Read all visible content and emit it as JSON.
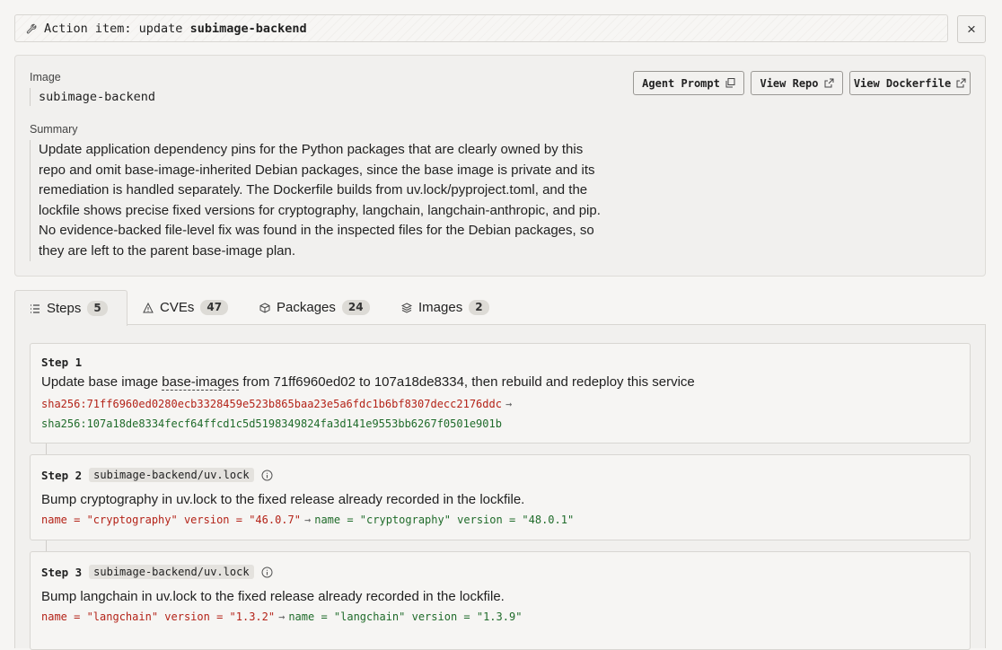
{
  "header": {
    "prefix": "Action item: update ",
    "name": "subimage-backend",
    "close": "×"
  },
  "info": {
    "image_label": "Image",
    "image_name": "subimage-backend",
    "summary_label": "Summary",
    "summary": "Update application dependency pins for the Python packages that are clearly owned by this repo and omit base-image-inherited Debian packages, since the base image is private and its remediation is handled separately. The Dockerfile builds from uv.lock/pyproject.toml, and the lockfile shows precise fixed versions for cryptography, langchain, langchain-anthropic, and pip. No evidence-backed file-level fix was found in the inspected files for the Debian packages, so they are left to the parent base-image plan.",
    "buttons": {
      "agent_prompt": "Agent Prompt",
      "view_repo": "View Repo",
      "view_dockerfile": "View Dockerfile"
    }
  },
  "tabs": [
    {
      "label": "Steps",
      "count": "5",
      "icon": "list-icon"
    },
    {
      "label": "CVEs",
      "count": "47",
      "icon": "warning-icon"
    },
    {
      "label": "Packages",
      "count": "24",
      "icon": "package-icon"
    },
    {
      "label": "Images",
      "count": "2",
      "icon": "layers-icon"
    }
  ],
  "steps": [
    {
      "label": "Step 1",
      "desc_pre": "Update base image ",
      "desc_link": "base-images",
      "desc_post": " from 71ff6960ed02 to 107a18de8334, then rebuild and redeploy this service",
      "old": "sha256:71ff6960ed0280ecb3328459e523b865baa23e5a6fdc1b6bf8307decc2176ddc",
      "arrow": "→",
      "new": "sha256:107a18de8334fecf64ffcd1c5d5198349824fa3d141e9553bb6267f0501e901b"
    },
    {
      "label": "Step 2",
      "file": "subimage-backend/uv.lock",
      "desc": "Bump cryptography in uv.lock to the fixed release already recorded in the lockfile.",
      "old": "name = \"cryptography\" version = \"46.0.7\"",
      "arrow": "→",
      "new": "name = \"cryptography\" version = \"48.0.1\""
    },
    {
      "label": "Step 3",
      "file": "subimage-backend/uv.lock",
      "desc": "Bump langchain in uv.lock to the fixed release already recorded in the lockfile.",
      "old": "name = \"langchain\" version = \"1.3.2\"",
      "arrow": "→",
      "new": "name = \"langchain\" version = \"1.3.9\""
    }
  ],
  "colors": {
    "old": "#b42318",
    "new": "#1f6b2a"
  }
}
